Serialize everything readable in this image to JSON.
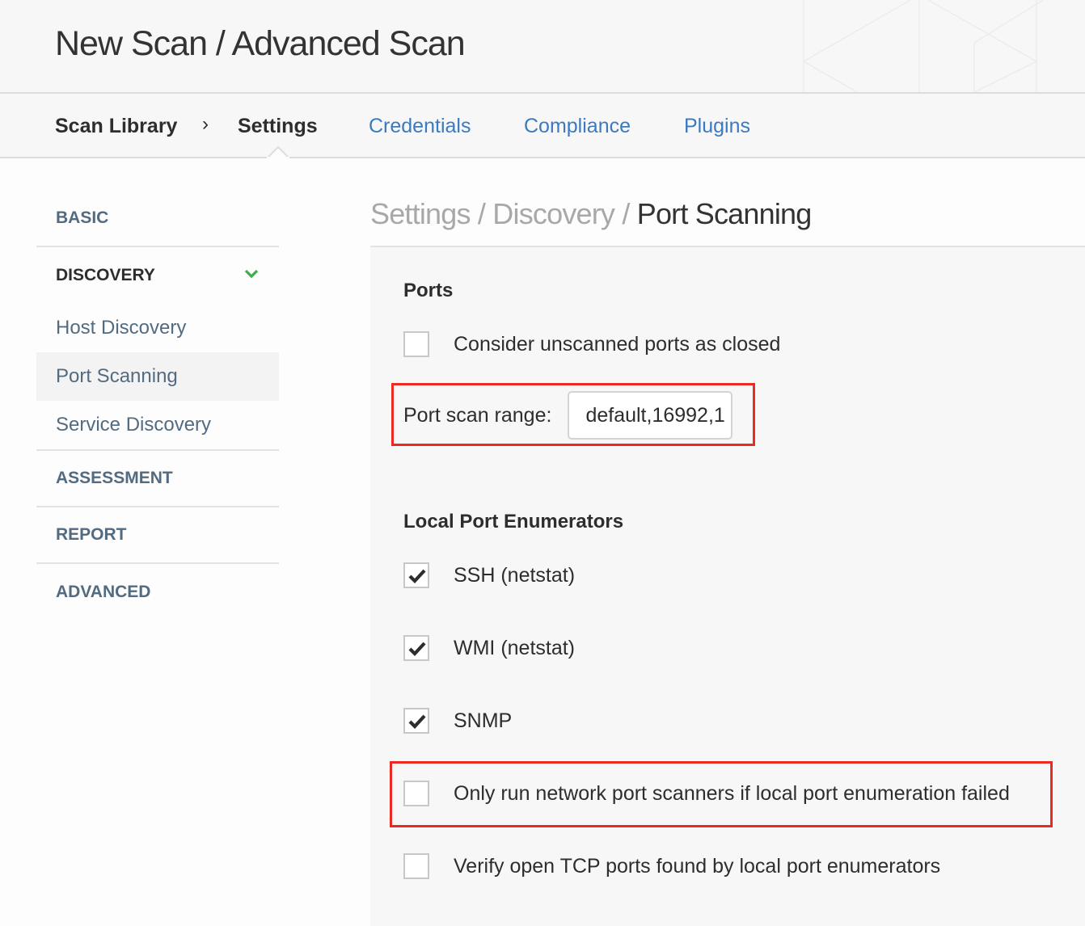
{
  "header": {
    "title": "New Scan / Advanced Scan"
  },
  "nav": {
    "breadcrumb": [
      "Scan Library",
      "Settings"
    ],
    "separator": "›",
    "tabs": [
      "Credentials",
      "Compliance",
      "Plugins"
    ],
    "active": "Settings"
  },
  "sidebar": {
    "sections": [
      {
        "label": "BASIC"
      },
      {
        "label": "DISCOVERY",
        "expanded": true,
        "items": [
          "Host Discovery",
          "Port Scanning",
          "Service Discovery"
        ],
        "selected": "Port Scanning"
      },
      {
        "label": "ASSESSMENT"
      },
      {
        "label": "REPORT"
      },
      {
        "label": "ADVANCED"
      }
    ]
  },
  "content": {
    "breadcrumb": {
      "parts": [
        "Settings",
        "Discovery"
      ],
      "separator": " / ",
      "current": "Port Scanning"
    },
    "ports": {
      "heading": "Ports",
      "consider_unscanned": {
        "label": "Consider unscanned ports as closed",
        "checked": false
      },
      "port_scan_range": {
        "label": "Port scan range:",
        "value": "default,16992,1"
      }
    },
    "local_enumerators": {
      "heading": "Local Port Enumerators",
      "options": [
        {
          "label": "SSH (netstat)",
          "checked": true
        },
        {
          "label": "WMI (netstat)",
          "checked": true
        },
        {
          "label": "SNMP",
          "checked": true
        },
        {
          "label": "Only run network port scanners if local port enumeration failed",
          "checked": false
        },
        {
          "label": "Verify open TCP ports found by local port enumerators",
          "checked": false
        }
      ]
    }
  },
  "colors": {
    "link": "#3c7ac0",
    "sidebar_text": "#536b80",
    "check_green": "#3fae49",
    "highlight_red": "#ea2a23"
  }
}
